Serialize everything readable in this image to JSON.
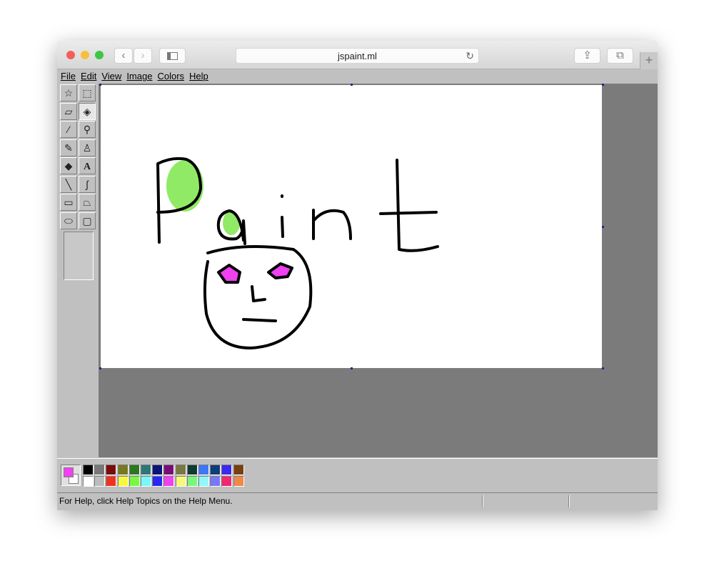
{
  "browser": {
    "url": "jspaint.ml",
    "back_icon": "chevron-left",
    "forward_icon": "chevron-right",
    "sidebar_icon": "sidebar",
    "reload_icon": "reload",
    "share_icon": "share",
    "tabs_icon": "tabs",
    "new_tab_icon": "plus"
  },
  "menu": [
    "File",
    "Edit",
    "View",
    "Image",
    "Colors",
    "Help"
  ],
  "tools": [
    {
      "name": "free-form-select",
      "glyph": "☆"
    },
    {
      "name": "select",
      "glyph": "⬚"
    },
    {
      "name": "eraser",
      "glyph": "▱"
    },
    {
      "name": "fill",
      "glyph": "◈",
      "selected": true
    },
    {
      "name": "pick-color",
      "glyph": "⁄"
    },
    {
      "name": "magnifier",
      "glyph": "⚲"
    },
    {
      "name": "pencil",
      "glyph": "✎"
    },
    {
      "name": "brush",
      "glyph": "♙"
    },
    {
      "name": "airbrush",
      "glyph": "◆"
    },
    {
      "name": "text",
      "glyph": "A"
    },
    {
      "name": "line",
      "glyph": "╲"
    },
    {
      "name": "curve",
      "glyph": "∫"
    },
    {
      "name": "rectangle",
      "glyph": "▭"
    },
    {
      "name": "polygon",
      "glyph": "⏢"
    },
    {
      "name": "ellipse",
      "glyph": "⬭"
    },
    {
      "name": "rounded-rectangle",
      "glyph": "▢"
    }
  ],
  "colors": {
    "primary": "#f040f0",
    "secondary": "#ffffff"
  },
  "palette": {
    "top": [
      "#000000",
      "#787878",
      "#780c0c",
      "#787820",
      "#2c7820",
      "#2c7878",
      "#0c1478",
      "#780c78",
      "#787840",
      "#103c30",
      "#3c78f8",
      "#103c78",
      "#3c28f0",
      "#784010"
    ],
    "bottom": [
      "#ffffff",
      "#bcbcbc",
      "#f03020",
      "#f8f840",
      "#78f840",
      "#78f8f8",
      "#2828f0",
      "#f040f0",
      "#f8f878",
      "#78f878",
      "#90f8f8",
      "#7878f8",
      "#f02870",
      "#f08848"
    ]
  },
  "status": {
    "text": "For Help, click Help Topics on the Help Menu."
  }
}
